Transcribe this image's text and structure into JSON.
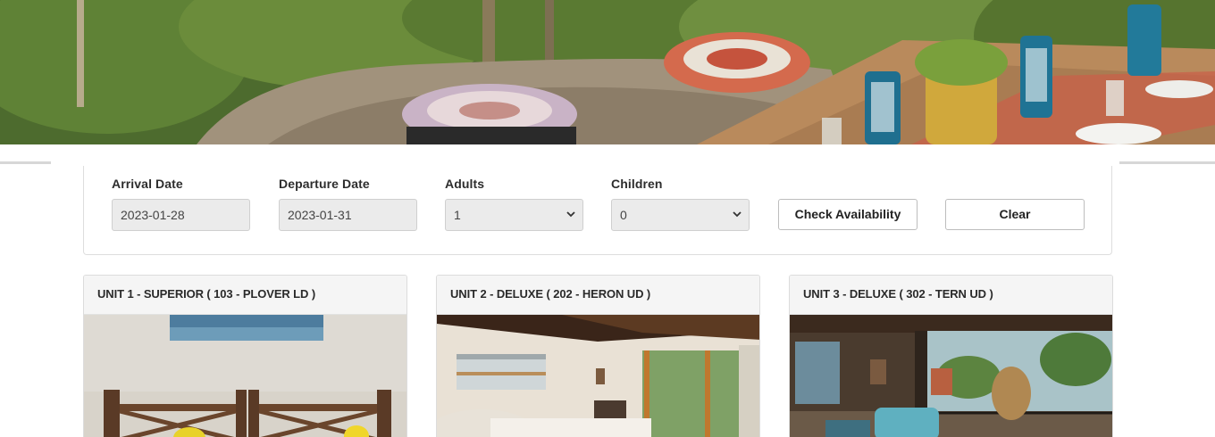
{
  "hero": {
    "image": "resort-deck-with-floor-cushions-and-lanterns"
  },
  "booking": {
    "arrival": {
      "label": "Arrival Date",
      "value": "2023-01-28"
    },
    "departure": {
      "label": "Departure Date",
      "value": "2023-01-31"
    },
    "adults": {
      "label": "Adults",
      "value": "1"
    },
    "children": {
      "label": "Children",
      "value": "0"
    },
    "check_button": "Check Availability",
    "clear_button": "Clear"
  },
  "units": [
    {
      "title": "UNIT 1 - SUPERIOR ( 103 - PLOVER LD )",
      "image": "bedroom-wooden-bed"
    },
    {
      "title": "UNIT 2 - DELUXE ( 202 - HERON UD )",
      "image": "bright-bedroom-with-balcony"
    },
    {
      "title": "UNIT 3 - DELUXE ( 302 - TERN UD )",
      "image": "veranda-with-hanging-chair"
    }
  ],
  "colors": {
    "input_bg": "#ebebeb",
    "border": "#dedede",
    "header_bg": "#f5f5f5"
  }
}
